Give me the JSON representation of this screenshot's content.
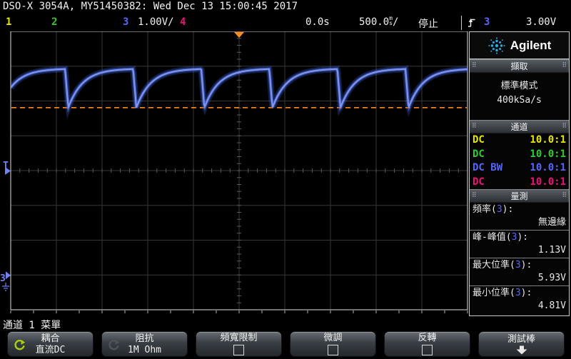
{
  "title_bar": "DSO-X 3054A, MY51450382: Wed Dec 13 15:00:45 2017",
  "status_bar": {
    "ch1": "1",
    "ch2": "2",
    "ch3": "3",
    "ch3_scale": "1.00V/",
    "ch4": "4",
    "delay": "0.0s",
    "timebase_value": "500.0",
    "timebase_unit_top": "m",
    "timebase_unit_bottom": "s",
    "timebase_suffix": "/",
    "run_state": "停止",
    "trigger_icon": "rising-edge",
    "trigger_channel": "3",
    "trigger_level": "3.00V"
  },
  "brand": {
    "name": "Agilent",
    "logo_color": "#2fa9e0"
  },
  "sidebar": {
    "acquire": {
      "header": "擷取",
      "mode": "標準模式",
      "sample_rate": "400kSa/s"
    },
    "channels": {
      "header": "通道",
      "rows": [
        {
          "coupling": "DC",
          "probe": "10.0:1",
          "color": "#e6e600"
        },
        {
          "coupling": "DC",
          "probe": "10.0:1",
          "color": "#2ecc2e"
        },
        {
          "coupling": "DC BW",
          "probe": "10.0:1",
          "color": "#5566ff"
        },
        {
          "coupling": "DC",
          "probe": "10.0:1",
          "color": "#ee1177"
        }
      ]
    },
    "measurements": {
      "header": "量測",
      "items": [
        {
          "name": "頻率",
          "channel": "3",
          "value": "無邊緣"
        },
        {
          "name": "峰-峰值",
          "channel": "3",
          "value": "1.13V"
        },
        {
          "name": "最大位準",
          "channel": "3",
          "value": "5.93V"
        },
        {
          "name": "最小位準",
          "channel": "3",
          "value": "4.81V"
        }
      ]
    }
  },
  "menu": {
    "title": "通道 1 菜單",
    "buttons": [
      {
        "label": "耦合",
        "value": "直流DC",
        "widget": "knob",
        "knob_active": true
      },
      {
        "label": "阻抗",
        "value": "1M Ohm",
        "widget": "knob",
        "knob_active": false
      },
      {
        "label": "頻寬限制",
        "widget": "checkbox",
        "checked": false
      },
      {
        "label": "微調",
        "widget": "checkbox",
        "checked": false
      },
      {
        "label": "反轉",
        "widget": "checkbox",
        "checked": false
      },
      {
        "label": "測試棒",
        "widget": "down-arrow"
      }
    ]
  },
  "waveform": {
    "channel": 3,
    "trace_color": "#5b79e8",
    "volts_per_div": 1.0,
    "flat_top_v": 5.93,
    "min_v": 4.81,
    "peak_to_peak_v": 1.13,
    "trigger_level_v": 3.0,
    "dashed_line_v": 4.81,
    "dashed_line_color": "#ff8c1a",
    "ground_div_above_bottom": 1.0,
    "first_drop_div": 1.19,
    "period_div": 1.49,
    "fall_width_div": 0.07,
    "recovery_tau_div": 0.32
  }
}
